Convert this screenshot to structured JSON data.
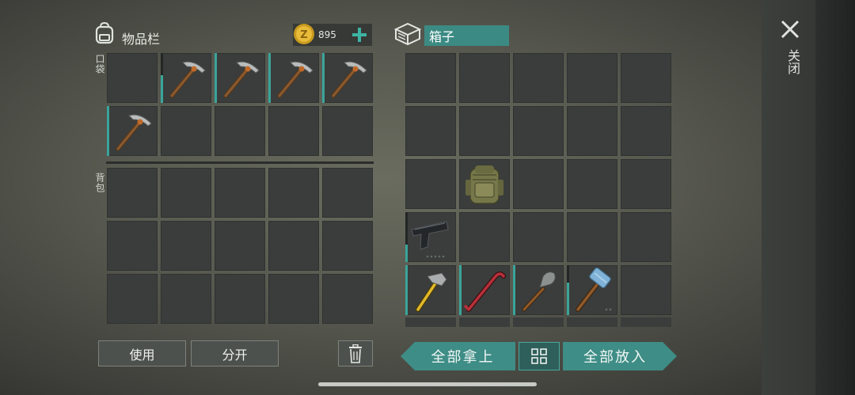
{
  "inventory": {
    "title": "物品栏",
    "coins": "895",
    "pocket_label": "口袋",
    "backpack_label": "背包",
    "pocket_slots": [
      {
        "item": "",
        "durability": 0
      },
      {
        "item": "pickaxe-icon",
        "durability": 0.55
      },
      {
        "item": "pickaxe-icon",
        "durability": 1.0
      },
      {
        "item": "pickaxe-icon",
        "durability": 1.0
      },
      {
        "item": "pickaxe-icon",
        "durability": 1.0
      },
      {
        "item": "pickaxe-icon",
        "durability": 1.0
      },
      {
        "item": "",
        "durability": 0
      },
      {
        "item": "",
        "durability": 0
      },
      {
        "item": "",
        "durability": 0
      },
      {
        "item": "",
        "durability": 0
      }
    ],
    "use_button": "使用",
    "split_button": "分开"
  },
  "container": {
    "name": "箱子",
    "slots": [
      {
        "item": "",
        "durability": 0
      },
      {
        "item": "",
        "durability": 0
      },
      {
        "item": "",
        "durability": 0
      },
      {
        "item": "",
        "durability": 0
      },
      {
        "item": "",
        "durability": 0
      },
      {
        "item": "",
        "durability": 0
      },
      {
        "item": "",
        "durability": 0
      },
      {
        "item": "",
        "durability": 0
      },
      {
        "item": "",
        "durability": 0
      },
      {
        "item": "",
        "durability": 0
      },
      {
        "item": "",
        "durability": 0
      },
      {
        "item": "backpack-icon",
        "durability": 0
      },
      {
        "item": "",
        "durability": 0
      },
      {
        "item": "",
        "durability": 0
      },
      {
        "item": "",
        "durability": 0
      },
      {
        "item": "pistol-icon",
        "durability": 0.35
      },
      {
        "item": "",
        "durability": 0
      },
      {
        "item": "",
        "durability": 0
      },
      {
        "item": "",
        "durability": 0
      },
      {
        "item": "",
        "durability": 0
      },
      {
        "item": "hammer-icon",
        "durability": 1.0
      },
      {
        "item": "crowbar-icon",
        "durability": 1.0
      },
      {
        "item": "shovel-icon",
        "durability": 1.0
      },
      {
        "item": "sledgehammer-icon",
        "durability": 0.65
      },
      {
        "item": "",
        "durability": 0
      }
    ],
    "take_all_button": "全部拿上",
    "put_all_button": "全部放入"
  },
  "close_label": "关闭",
  "colors": {
    "accent": "#3e8d86",
    "durability": "#3aa49a",
    "slot": "#3a3d3b"
  }
}
